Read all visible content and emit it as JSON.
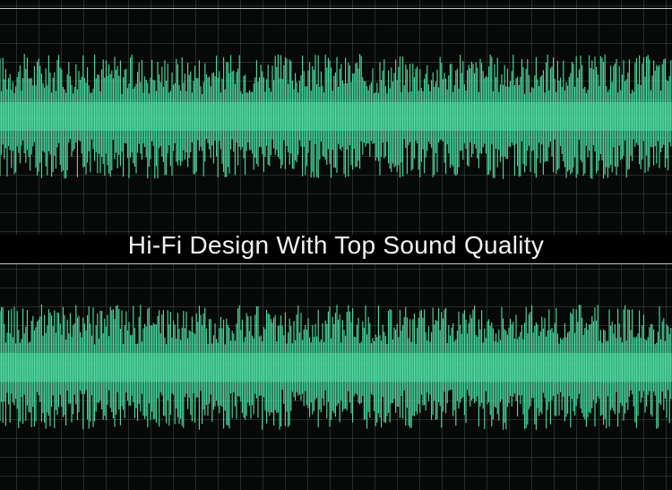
{
  "headline": "Hi‑Fi Design With Top Sound Quality",
  "colors": {
    "background": "#000000",
    "grid": "#465a55",
    "waveform": "#4fe0a4",
    "rule": "#bfc6c4",
    "text": "#f2f2f2"
  },
  "waveforms": [
    {
      "name": "top-waveform"
    },
    {
      "name": "bottom-waveform"
    }
  ]
}
